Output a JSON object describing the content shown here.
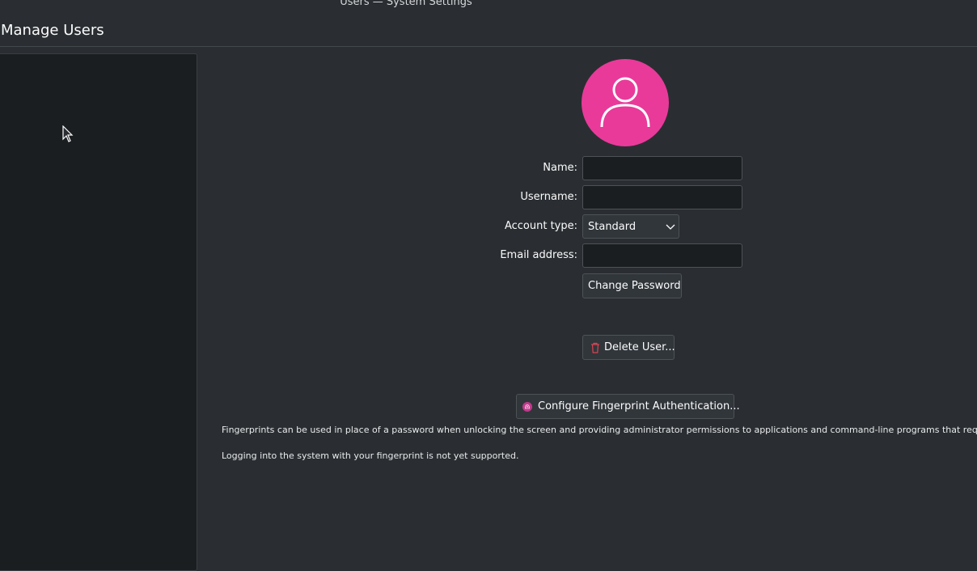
{
  "window": {
    "title": "Users — System Settings"
  },
  "header": {
    "title": "Manage Users"
  },
  "form": {
    "name_label": "Name:",
    "name_value": "",
    "username_label": "Username:",
    "username_value": "",
    "account_type_label": "Account type:",
    "account_type_value": "Standard",
    "email_label": "Email address:",
    "email_value": ""
  },
  "buttons": {
    "change_password": "Change Password",
    "delete_user": "Delete User...",
    "configure_fingerprint": "Configure Fingerprint Authentication..."
  },
  "info": {
    "fingerprint_description": "Fingerprints can be used in place of a password when unlocking the screen and providing administrator permissions to applications and command-line programs that request them.",
    "fingerprint_login_note": "Logging into the system with your fingerprint is not yet supported."
  },
  "icons": {
    "avatar": "user-icon",
    "delete": "trash-icon",
    "fingerprint": "fingerprint-icon",
    "dropdown": "chevron-down-icon",
    "cursor": "mouse-pointer-icon"
  },
  "colors": {
    "avatar_background": "#e93a9a",
    "delete_icon": "#da4453",
    "window_background": "#2a2e32",
    "list_background": "#1b1e20"
  }
}
